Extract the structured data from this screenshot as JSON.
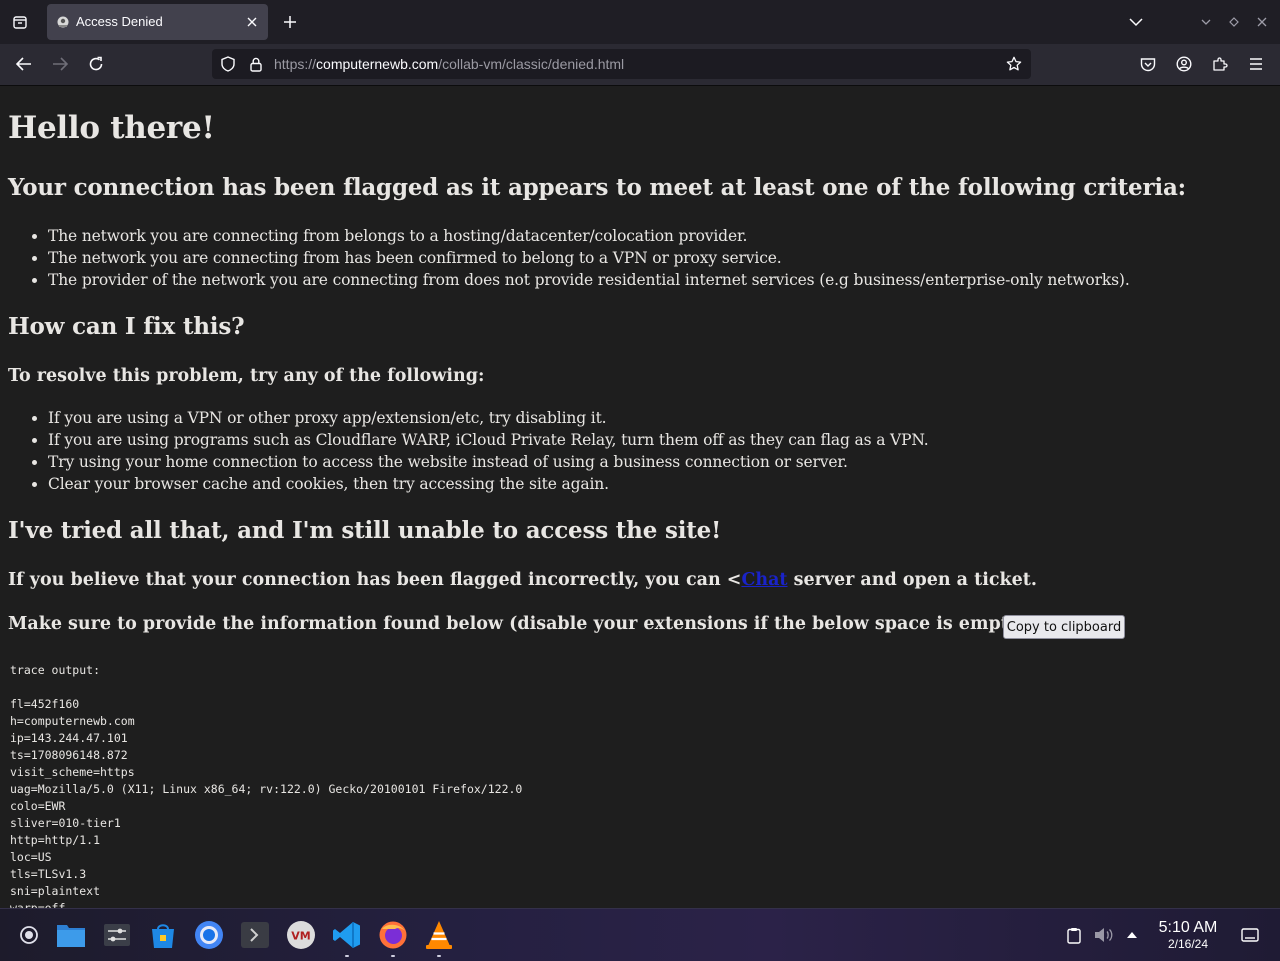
{
  "browser": {
    "tab_title": "Access Denied",
    "url_scheme": "https://",
    "url_host": "computernewb.com",
    "url_path": "/collab-vm/classic/denied.html"
  },
  "page": {
    "heading": "Hello there!",
    "flagged_heading": "Your connection has been flagged as it appears to meet at least one of the following criteria:",
    "criteria": [
      "The network you are connecting from belongs to a hosting/datacenter/colocation provider.",
      "The network you are connecting from has been confirmed to belong to a VPN or proxy service.",
      "The provider of the network you are connecting from does not provide residential internet services (e.g business/enterprise-only networks)."
    ],
    "fix_heading": "How can I fix this?",
    "resolve_heading": "To resolve this problem, try any of the following:",
    "fixes": [
      "If you are using a VPN or other proxy app/extension/etc, try disabling it.",
      "If you are using programs such as Cloudflare WARP, iCloud Private Relay, turn them off as they can flag as a VPN.",
      "Try using your home connection to access the website instead of using a business connection or server.",
      "Clear your browser cache and cookies, then try accessing the site again."
    ],
    "still_heading": "I've tried all that, and I'm still unable to access the site!",
    "believe_text_before": "If you believe that your connection has been flagged incorrectly, you can <",
    "chat_link": "Chat",
    "believe_text_after": " server and open a ticket.",
    "provide_text": "Make sure to provide the information found below (disable your extensions if the below space is empty):",
    "copy_button": "Copy to clipboard",
    "trace_output": "trace output:\n\nfl=452f160\nh=computernewb.com\nip=143.244.47.101\nts=1708096148.872\nvisit_scheme=https\nuag=Mozilla/5.0 (X11; Linux x86_64; rv:122.0) Gecko/20100101 Firefox/122.0\ncolo=EWR\nsliver=010-tier1\nhttp=http/1.1\nloc=US\ntls=TLSv1.3\nsni=plaintext\nwarp=off"
  },
  "taskbar": {
    "time": "5:10 AM",
    "date": "2/16/24",
    "apps": [
      "app-launcher-icon",
      "file-manager-icon",
      "settings-icon",
      "software-center-icon",
      "chromium-icon",
      "terminal-icon",
      "virt-manager-icon",
      "vscode-icon",
      "firefox-icon",
      "vlc-icon"
    ]
  },
  "colors": {
    "page_bg": "#1e1e1e",
    "page_text": "#e8e6e3",
    "link": "#1a23c9",
    "chrome_bg": "#2b2a33"
  }
}
